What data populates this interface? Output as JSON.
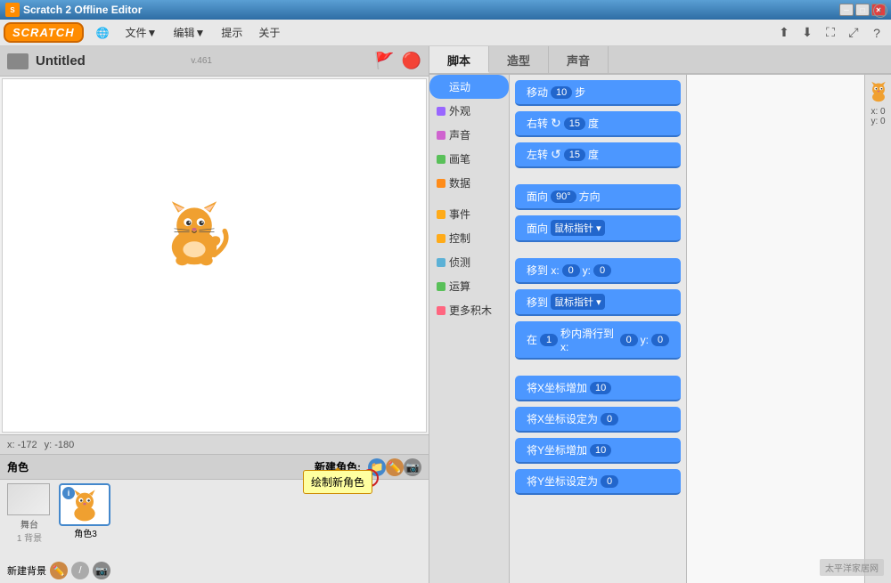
{
  "titlebar": {
    "icon_text": "S",
    "title": "Scratch 2 Offline Editor",
    "btn_min": "─",
    "btn_max": "□",
    "btn_close": "✕"
  },
  "menubar": {
    "logo": "SCRATCH",
    "globe": "🌐",
    "file": "文件▼",
    "edit": "编辑▼",
    "tips": "提示",
    "about": "关于",
    "upload_icon": "⬆",
    "download_icon": "⬇",
    "fullscreen_icon": "⛶",
    "resize_icon": "⤢",
    "help_icon": "?"
  },
  "stage": {
    "title": "Untitled",
    "version": "v.461",
    "green_flag": "⚑",
    "stop": "⬤",
    "coord_x": "x: -172",
    "coord_y": "y: -180"
  },
  "tabs": {
    "script": "脚本",
    "costume": "造型",
    "sound": "声音"
  },
  "categories": [
    {
      "id": "motion",
      "label": "运动",
      "color": "#4c97ff",
      "active": true
    },
    {
      "id": "looks",
      "label": "外观",
      "color": "#9966ff",
      "active": false
    },
    {
      "id": "sound",
      "label": "声音",
      "color": "#cf63cf",
      "active": false
    },
    {
      "id": "pen",
      "label": "画笔",
      "color": "#59c059",
      "active": false
    },
    {
      "id": "data",
      "label": "数据",
      "color": "#ff8c1a",
      "active": false
    },
    {
      "id": "events",
      "label": "事件",
      "color": "#ffab19",
      "active": false
    },
    {
      "id": "control",
      "label": "控制",
      "color": "#ffab19",
      "active": false
    },
    {
      "id": "sensing",
      "label": "侦测",
      "color": "#5cb1d6",
      "active": false
    },
    {
      "id": "operators",
      "label": "运算",
      "color": "#59c059",
      "active": false
    },
    {
      "id": "more",
      "label": "更多积木",
      "color": "#ff6680",
      "active": false
    }
  ],
  "blocks": [
    {
      "id": "move",
      "text": "移动",
      "input": "10",
      "suffix": "步"
    },
    {
      "id": "turn_right",
      "text": "右转",
      "icon": "↻",
      "input": "15",
      "suffix": "度"
    },
    {
      "id": "turn_left",
      "text": "左转",
      "icon": "↺",
      "input": "15",
      "suffix": "度"
    },
    {
      "id": "face_dir",
      "text": "面向",
      "input": "90°",
      "suffix": "方向"
    },
    {
      "id": "face_mouse",
      "text": "面向",
      "dropdown": "鼠标指针",
      "suffix": ""
    },
    {
      "id": "goto",
      "text": "移到 x:",
      "x_input": "0",
      "y_text": "y:",
      "y_input": "0"
    },
    {
      "id": "goto_mouse",
      "text": "移到",
      "dropdown": "鼠标指针"
    },
    {
      "id": "glide",
      "text": "在",
      "input": "1",
      "suffix2": "秒内滑行到 x:",
      "x_input": "0",
      "y_text": "y:",
      "y_input": "0"
    },
    {
      "id": "change_x",
      "text": "将X坐标增加",
      "input": "10"
    },
    {
      "id": "set_x",
      "text": "将X坐标设定为",
      "input": "0"
    },
    {
      "id": "change_y",
      "text": "将Y坐标增加",
      "input": "10"
    },
    {
      "id": "set_y",
      "text": "将Y坐标设定为",
      "input": "0"
    }
  ],
  "sprite_panel": {
    "header": "角色",
    "new_sprite_label": "新建角色:",
    "sprite_name": "角色3",
    "stage_label": "舞台",
    "stage_sublabel": "1 背景",
    "new_bg_label": "新建背景",
    "tooltip": "绘制新角色"
  },
  "right_info": {
    "x": "x: 0",
    "y": "y: 0"
  },
  "watermark": "太平洋家居网"
}
